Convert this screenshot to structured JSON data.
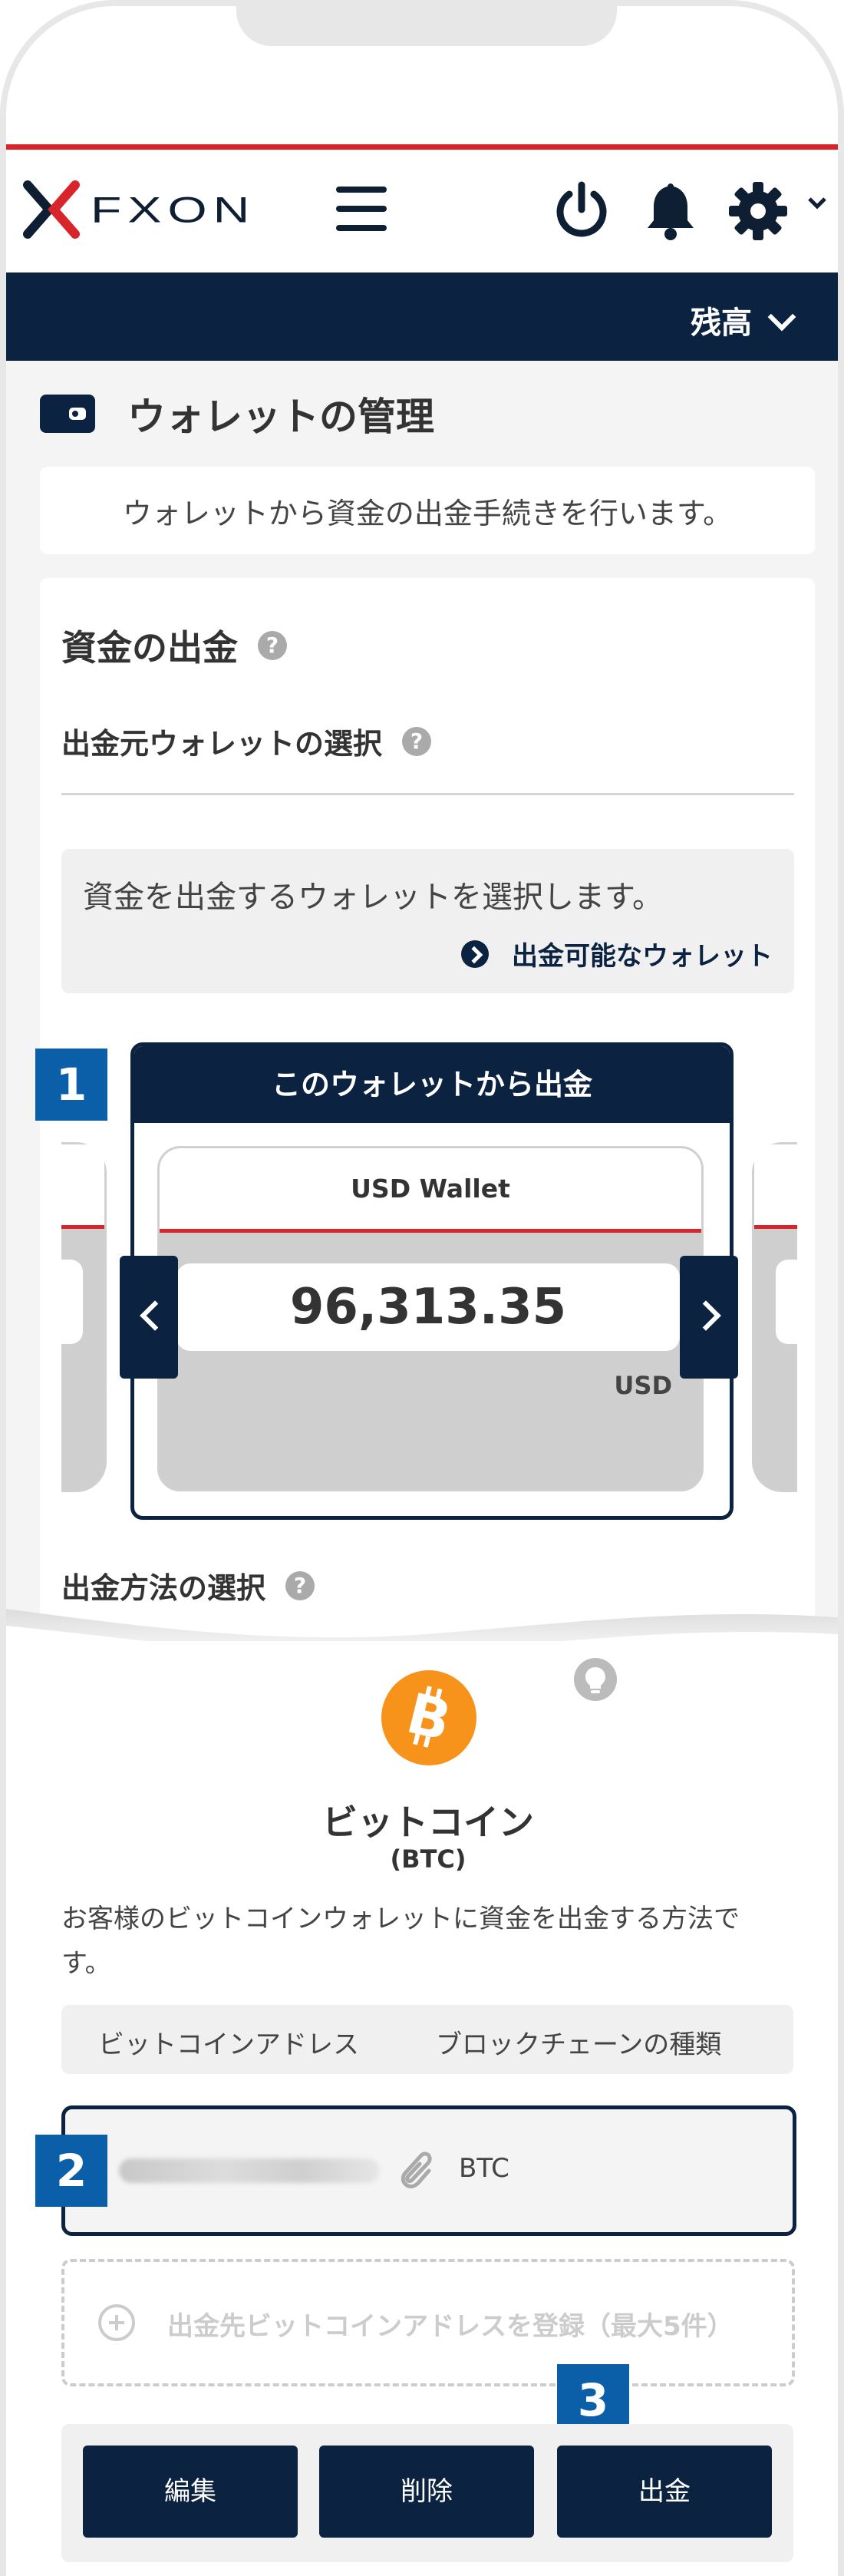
{
  "header": {
    "logo_text": "FXON",
    "balance_label": "残高"
  },
  "page": {
    "title": "ウォレットの管理",
    "description": "ウォレットから資金の出金手続きを行います。"
  },
  "withdraw": {
    "section_title": "資金の出金",
    "source_title": "出金元ウォレットの選択",
    "info_text": "資金を出金するウォレットを選択します。",
    "link_label": "出金可能なウォレット",
    "wallet_header": "このウォレットから出金",
    "wallet_name": "USD Wallet",
    "wallet_amount": "96,313.35",
    "wallet_currency": "USD",
    "method_title": "出金方法の選択"
  },
  "method": {
    "name": "ビットコイン",
    "code": "(BTC)",
    "description": "お客様のビットコインウォレットに資金を出金する方法です。",
    "col_address": "ビットコインアドレス",
    "col_chain": "ブロックチェーンの種類",
    "row_chain": "BTC",
    "register_label": "出金先ビットコインアドレスを登録（最大5件）"
  },
  "actions": {
    "edit": "編集",
    "delete": "削除",
    "withdraw": "出金"
  },
  "badges": [
    "1",
    "2",
    "3"
  ],
  "colors": {
    "navy": "#0b2341",
    "red": "#d8252c",
    "badge_blue": "#0b5fa8",
    "bitcoin_orange": "#f7931a"
  }
}
